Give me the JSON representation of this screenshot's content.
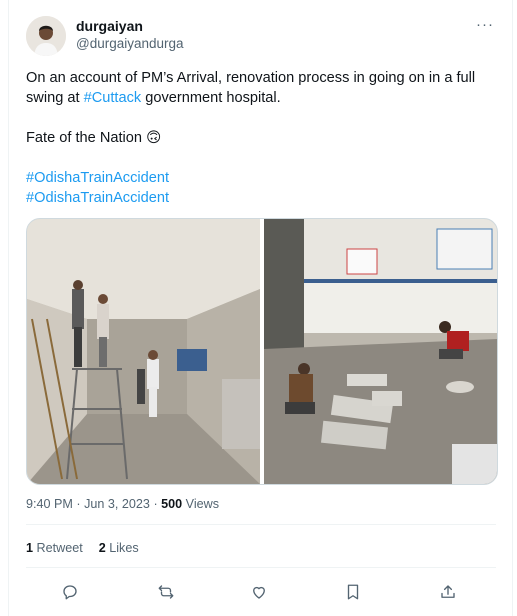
{
  "tweet": {
    "author": {
      "display_name": "durgaiyan",
      "handle": "@durgaiyandurga"
    },
    "more_label": "···",
    "text": {
      "line1_pre": "On an account of PM’s Arrival, renovation process in going on in a full swing at ",
      "line1_hashtag": "#Cuttack",
      "line1_post": " government hospital.",
      "line2": "Fate of the Nation 🙃",
      "hashtags": [
        "#OdishaTrainAccident",
        "#OdishaTrainAccident"
      ]
    },
    "meta": {
      "time": "9:40 PM",
      "separator": "·",
      "date": "Jun 3, 2023",
      "views_count": "500",
      "views_label": "Views"
    },
    "stats": {
      "retweets_count": "1",
      "retweets_label": "Retweet",
      "likes_count": "2",
      "likes_label": "Likes"
    },
    "actions": [
      "reply-icon",
      "retweet-icon",
      "like-icon",
      "bookmark-icon",
      "share-icon"
    ]
  }
}
